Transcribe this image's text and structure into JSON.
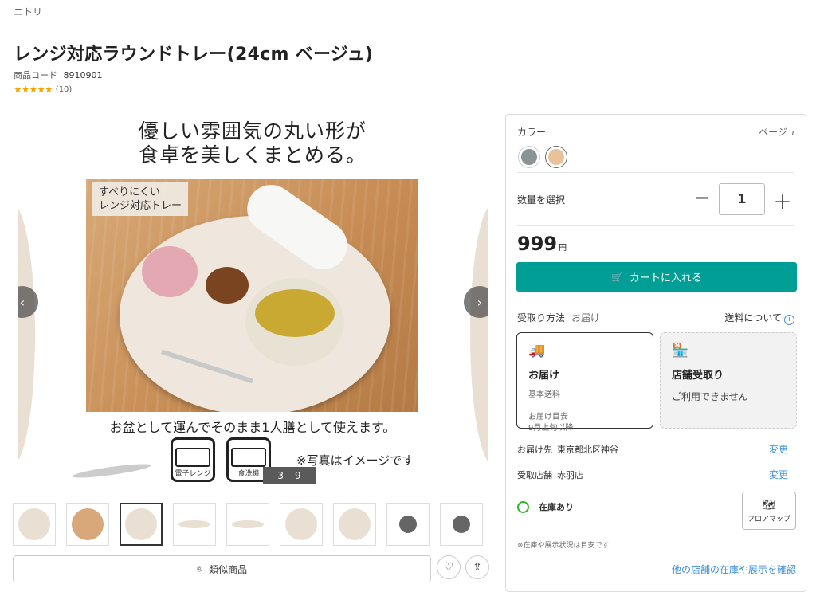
{
  "brand": "ニトリ",
  "product": {
    "title": "レンジ対応ラウンドトレー(24cm ベージュ)",
    "code_label": "商品コード",
    "code": "8910901",
    "stars": "★★★★★",
    "review_count": "(10)"
  },
  "gallery": {
    "caption_line1": "優しい雰囲気の丸い形が",
    "caption_line2": "食卓を美しくまとめる。",
    "tag_line1": "すべりにくい",
    "tag_line2": "レンジ対応トレー",
    "caption_bottom": "お盆として運んでそのまま1人膳として使えます。",
    "icon1_label": "電子レンジ",
    "icon2_label": "食洗機",
    "note": "※写真はイメージです",
    "current": "3",
    "total": "9",
    "prev_arrow": "‹",
    "next_arrow": "›",
    "thumb_count": 9,
    "active_thumb": 2
  },
  "actions": {
    "similar_label": "類似商品",
    "similar_icon": "⌾",
    "favorite_icon": "♡",
    "share_icon": "⇪"
  },
  "panel": {
    "color_label": "カラー",
    "color_value": "ベージュ",
    "swatches": [
      "#8a9494",
      "#e7c29a"
    ],
    "qty_label": "数量を選択",
    "qty_minus": "−",
    "qty_value": "1",
    "qty_plus": "＋",
    "price": "999",
    "price_unit": "円",
    "cart_icon": "🛒",
    "cart_label": "カートに入れる",
    "receive_label": "受取り方法",
    "receive_value": "お届け",
    "shipping_label": "送料について",
    "shipping_icon": "i",
    "option1": {
      "icon": "🚚",
      "title": "お届け",
      "sub1": "基本送料",
      "sub2": "お届け目安",
      "sub3": "9月上旬以降"
    },
    "option2": {
      "icon": "🏪",
      "title": "店舗受取り",
      "sub": "ご利用できません"
    },
    "dest_label": "お届け先",
    "dest_value": "東京都北区神谷",
    "change1": "変更",
    "store_label": "受取店舗",
    "store_value": "赤羽店",
    "change2": "変更",
    "stock_label": "在庫あり",
    "floor_icon": "🗺",
    "floor_label": "フロアマップ",
    "stock_note": "※在庫や展示状況は目安です",
    "other_stores": "他の店舗の在庫や展示を確認"
  }
}
